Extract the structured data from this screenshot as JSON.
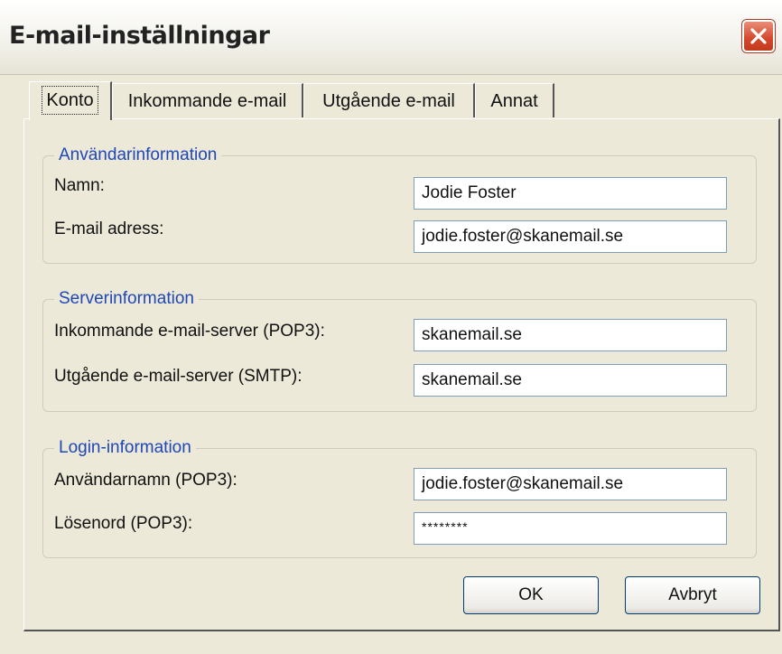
{
  "window": {
    "title": "E-mail-inställningar"
  },
  "tabs": [
    {
      "label": "Konto",
      "active": true
    },
    {
      "label": "Inkommande e-mail",
      "active": false
    },
    {
      "label": "Utgående e-mail",
      "active": false
    },
    {
      "label": "Annat",
      "active": false
    }
  ],
  "user_info": {
    "group_title": "Användarinformation",
    "name_label": "Namn:",
    "name_value": "Jodie Foster",
    "email_label": "E-mail adress:",
    "email_value": "jodie.foster@skanemail.se"
  },
  "server_info": {
    "group_title": "Serverinformation",
    "incoming_label": "Inkommande e-mail-server (POP3):",
    "incoming_value": "skanemail.se",
    "outgoing_label": "Utgående e-mail-server (SMTP):",
    "outgoing_value": "skanemail.se"
  },
  "login_info": {
    "group_title": "Login-information",
    "username_label": "Användarnamn (POP3):",
    "username_value": "jodie.foster@skanemail.se",
    "password_label": "Lösenord (POP3):",
    "password_value": "********"
  },
  "buttons": {
    "ok_label": "OK",
    "cancel_label": "Avbryt"
  },
  "colors": {
    "group_title": "#1f47b8",
    "close_button": "#d3472a",
    "field_border": "#7f9db9"
  },
  "icons": {
    "close": "close-icon"
  }
}
